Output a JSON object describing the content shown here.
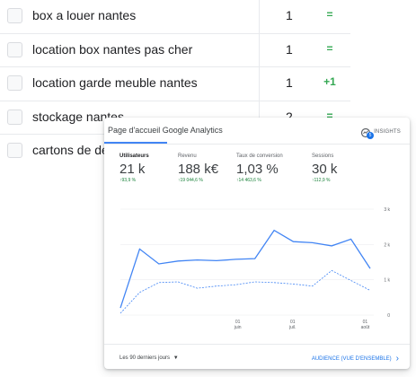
{
  "keywords": [
    {
      "label": "box a louer nantes",
      "rank": "1",
      "change": "="
    },
    {
      "label": "location box nantes pas cher",
      "rank": "1",
      "change": "="
    },
    {
      "label": "location garde meuble nantes",
      "rank": "1",
      "change": "+1"
    },
    {
      "label": "stockage nantes",
      "rank": "2",
      "change": "="
    },
    {
      "label": "cartons de de",
      "rank": "",
      "change": ""
    }
  ],
  "analytics": {
    "tab_label": "Page d'accueil Google Analytics",
    "insights_label": "INSIGHTS",
    "insights_badge": "5",
    "metrics": [
      {
        "name": "Utilisateurs",
        "value": "21 k",
        "delta": "↑93,9 %"
      },
      {
        "name": "Revenu",
        "value": "188 k€",
        "delta": "↑19 044,6 %"
      },
      {
        "name": "Taux de conversion",
        "value": "1,03 %",
        "delta": "↑14 463,6 %"
      },
      {
        "name": "Sessions",
        "value": "30 k",
        "delta": "↑112,9 %"
      }
    ],
    "date_range": "Les 90 derniers jours",
    "audience_link": "AUDIENCE (VUE D'ENSEMBLE)"
  },
  "chart_data": {
    "type": "line",
    "x": [
      "",
      "",
      "01 juin",
      "",
      "",
      "",
      "",
      "01 juil.",
      "",
      "",
      "01 août"
    ],
    "x_tick_labels": [
      {
        "day": "01",
        "month": "juin"
      },
      {
        "day": "01",
        "month": "juil."
      },
      {
        "day": "01",
        "month": "août"
      }
    ],
    "y_tick_labels": [
      "0",
      "1 k",
      "2 k",
      "3 k"
    ],
    "ylim": [
      0,
      3000
    ],
    "series": [
      {
        "values": [
          200,
          1870,
          1450,
          1530,
          1560,
          1540,
          1580,
          1600,
          2400,
          2080,
          2050,
          1960,
          2150,
          1320
        ],
        "color": "#4285f4",
        "style": "solid"
      },
      {
        "values": [
          50,
          640,
          920,
          940,
          760,
          820,
          860,
          940,
          920,
          880,
          820,
          1260,
          980,
          700
        ],
        "color": "#4285f4",
        "style": "dashed"
      }
    ]
  }
}
